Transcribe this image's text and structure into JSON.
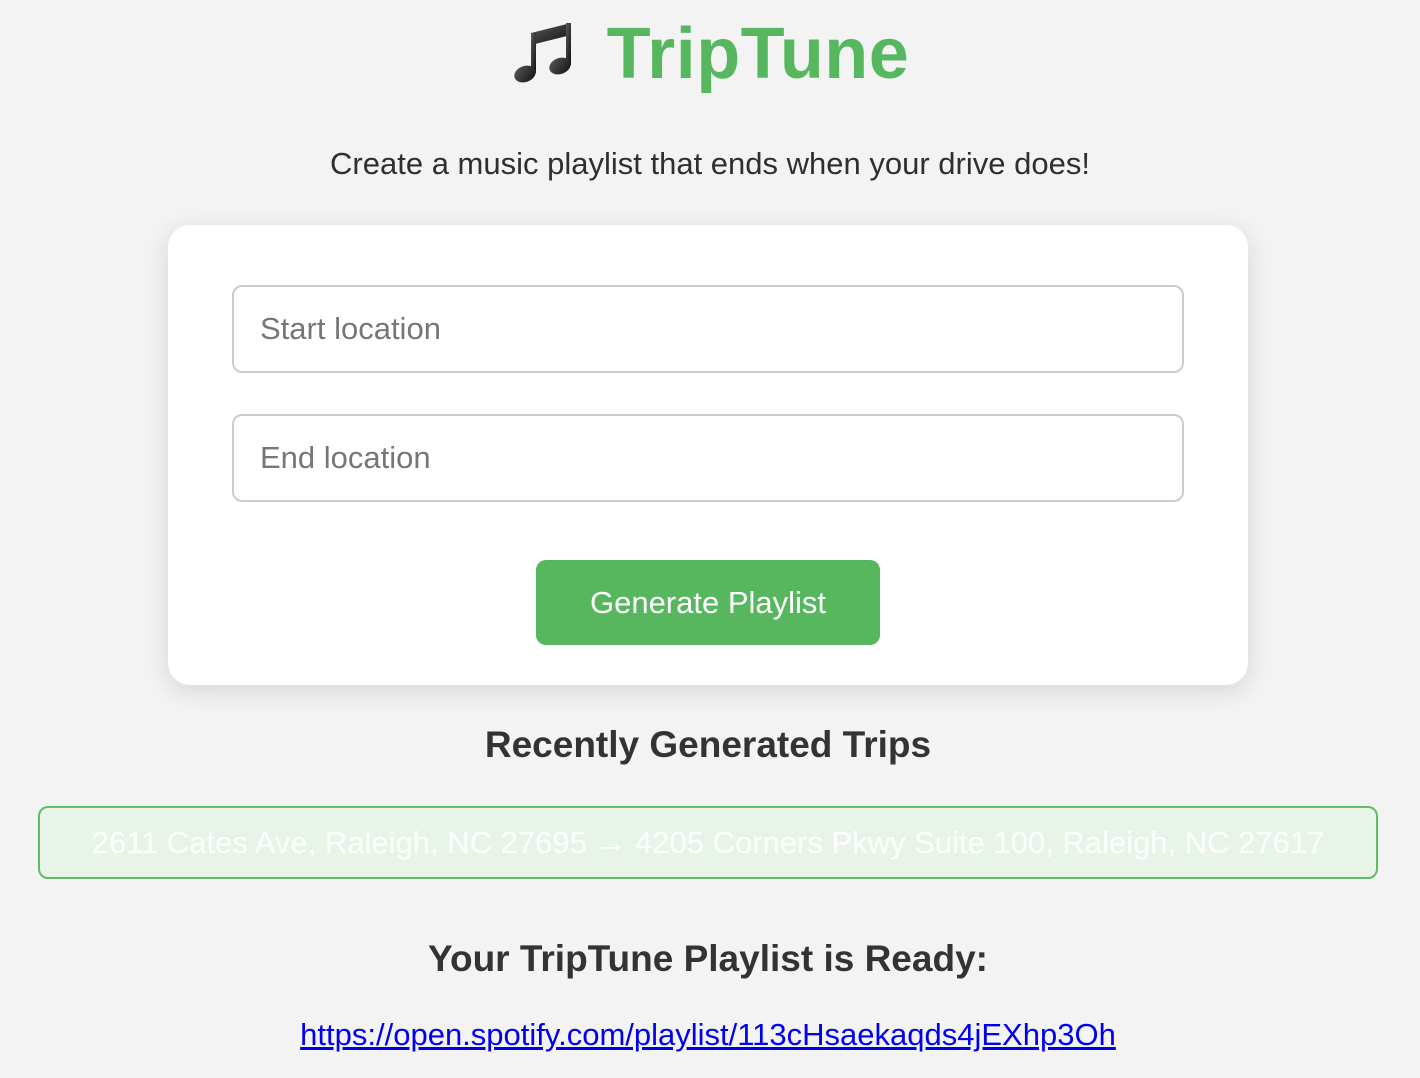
{
  "header": {
    "icon": "music-note-icon",
    "title": "TripTune",
    "title_color": "#57b75f"
  },
  "tagline": "Create a music playlist that ends when your drive does!",
  "form": {
    "start_placeholder": "Start location",
    "start_value": "",
    "end_placeholder": "End location",
    "end_value": "",
    "generate_label": "Generate Playlist",
    "button_color": "#57b75f"
  },
  "recent": {
    "heading": "Recently Generated Trips",
    "trips": [
      {
        "label": "2611 Cates Ave, Raleigh, NC 27695 → 4205 Corners Pkwy Suite 100, Raleigh, NC 27617"
      }
    ]
  },
  "result": {
    "heading": "Your TripTune Playlist is Ready:",
    "link_text": "https://open.spotify.com/playlist/113cHsaekaqds4jEXhp3Oh",
    "link_color": "#0000ee"
  }
}
